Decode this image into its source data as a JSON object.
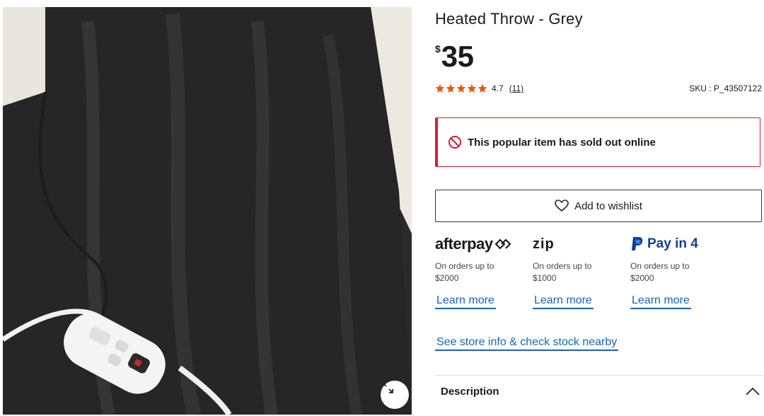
{
  "product": {
    "title": "Heated Throw - Grey",
    "currency": "$",
    "price": "35",
    "rating": "4.7",
    "review_count": "(11)",
    "sku": "SKU : P_43507122",
    "stars": 5
  },
  "alert": {
    "message": "This popular item has sold out online"
  },
  "wishlist": {
    "label": "Add to wishlist"
  },
  "payments": [
    {
      "brand": "afterpay",
      "desc_line1": "On orders up to",
      "desc_line2": "$2000",
      "link": "Learn more"
    },
    {
      "brand": "zip",
      "desc_line1": "On orders up to",
      "desc_line2": "$1000",
      "link": "Learn more"
    },
    {
      "brand": "Pay in 4",
      "desc_line1": "On orders up to",
      "desc_line2": "$2000",
      "link": "Learn more"
    }
  ],
  "store": {
    "link": "See store info & check stock nearby"
  },
  "accordion": {
    "label": "Description"
  },
  "colors": {
    "accent_link": "#1565c0",
    "alert": "#d01f3a",
    "star": "#e8590c"
  }
}
